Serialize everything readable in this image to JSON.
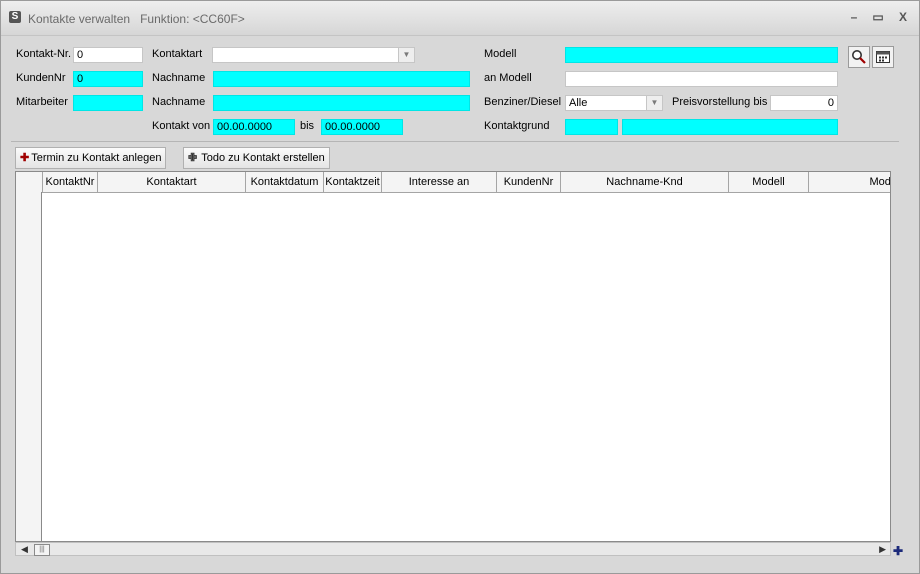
{
  "window": {
    "title": "Kontakte verwalten",
    "function": "Funktion: <CC60F>",
    "app_icon": "app-logo-icon",
    "minimize": "–",
    "maximize": "▭",
    "close": "X"
  },
  "filters": {
    "kontakt_nr_label": "Kontakt-Nr.",
    "kontakt_nr_value": "0",
    "kunden_nr_label": "KundenNr",
    "kunden_nr_value": "0",
    "mitarbeiter_label": "Mitarbeiter",
    "mitarbeiter_value": "",
    "kontaktart_label": "Kontaktart",
    "kontaktart_value": "",
    "nachname1_label": "Nachname",
    "nachname1_value": "",
    "nachname2_label": "Nachname",
    "nachname2_value": "",
    "kontakt_von_label": "Kontakt von",
    "kontakt_von_value": "00.00.0000",
    "bis_label": "bis",
    "bis_value": "00.00.0000",
    "modell_label": "Modell",
    "modell_value": "",
    "an_modell_label": "an Modell",
    "an_modell_value": "",
    "kraftstoff_label": "Benziner/Diesel",
    "kraftstoff_value": "Alle",
    "preis_label": "Preisvorstellung bis",
    "preis_value": "0",
    "kontaktgrund_label": "Kontaktgrund",
    "kontaktgrund_code": "",
    "kontaktgrund_text": ""
  },
  "tool_icons": {
    "search": "magnifier-icon",
    "calendar": "calendar-icon"
  },
  "actions": {
    "termin": "Termin zu Kontakt anlegen",
    "todo": "Todo zu Kontakt erstellen"
  },
  "table": {
    "columns": [
      {
        "label": "KontaktNr"
      },
      {
        "label": "Kontaktart"
      },
      {
        "label": "Kontaktdatum"
      },
      {
        "label": "Kontaktzeit"
      },
      {
        "label": "Interesse an"
      },
      {
        "label": "KundenNr"
      },
      {
        "label": "Nachname-Knd"
      },
      {
        "label": "Modell"
      },
      {
        "label": "Mode"
      }
    ],
    "rows": []
  },
  "colors": {
    "required_field": "#00ffff",
    "panel": "#d8d8d8"
  }
}
